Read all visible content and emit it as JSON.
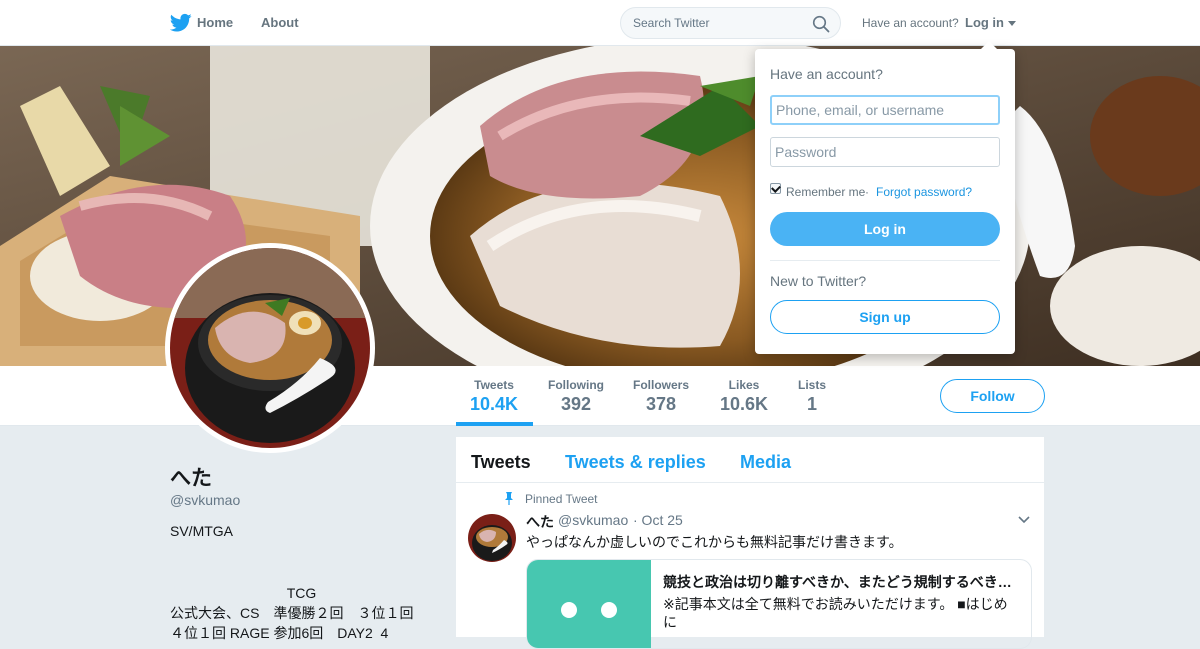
{
  "nav": {
    "home_label": "Home",
    "about_label": "About",
    "search_placeholder": "Search Twitter",
    "have_account": "Have an account?",
    "login_label": "Log in"
  },
  "profile_nav": {
    "stats": [
      {
        "label": "Tweets",
        "value": "10.4K"
      },
      {
        "label": "Following",
        "value": "392"
      },
      {
        "label": "Followers",
        "value": "378"
      },
      {
        "label": "Likes",
        "value": "10.6K"
      },
      {
        "label": "Lists",
        "value": "1"
      }
    ],
    "follow_label": "Follow"
  },
  "profile": {
    "name": "へた",
    "handle": "@svkumao",
    "bio_line1": "SV/MTGA",
    "bio_line2": "                              TCG\n公式大会、CS　準優勝２回　３位１回　４位１回 RAGE 参加6回　DAY2  4"
  },
  "timeline": {
    "tabs": [
      "Tweets",
      "Tweets & replies",
      "Media"
    ],
    "pinned_label": "Pinned Tweet",
    "tweet": {
      "name": "へた",
      "handle": "@svkumao",
      "date": "· Oct 25",
      "text": "やっぱなんか虚しいのでこれからも無料記事だけ書きます。",
      "card_title": "競技と政治は切り離すべきか、またどう規制するべきか？",
      "card_desc": "※記事本文は全て無料でお読みいただけます。 ■はじめに"
    }
  },
  "login_dropdown": {
    "title": "Have an account?",
    "username_placeholder": "Phone, email, or username",
    "password_placeholder": "Password",
    "remember_label": "Remember me",
    "separator": "·",
    "forgot_label": "Forgot password?",
    "login_button": "Log in",
    "new_label": "New to Twitter?",
    "signup_button": "Sign up"
  },
  "colors": {
    "accent": "#1da1f2",
    "login_button": "#4ab3f4",
    "background": "#e6ecf0",
    "card_image": "#47c7b0"
  }
}
